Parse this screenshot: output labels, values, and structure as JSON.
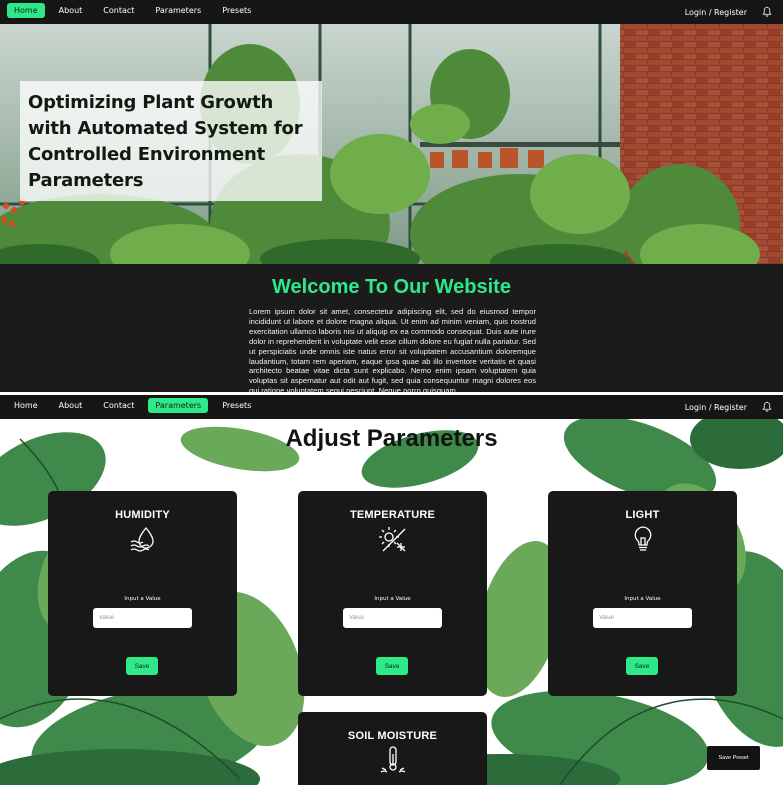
{
  "nav": {
    "links": [
      "Home",
      "About",
      "Contact",
      "Parameters",
      "Presets"
    ],
    "login": "Login / Register"
  },
  "hero": {
    "title": "Optimizing Plant Growth with Automated System for Controlled Environment Parameters"
  },
  "welcome": {
    "title": "Welcome To Our Website",
    "body": "Lorem ipsum dolor sit amet, consectetur adipiscing elit, sed do eiusmod tempor incididunt ut labore et dolore magna aliqua. Ut enim ad minim veniam, quis nostrud exercitation ullamco laboris nisi ut aliquip ex ea commodo consequat. Duis aute irure dolor in reprehenderit in voluptate velit esse cillum dolore eu fugiat nulla pariatur. Sed ut perspiciatis unde omnis iste natus error sit voluptatem accusantium doloremque laudantium, totam rem aperiam, eaque ipsa quae ab illo inventore veritatis et quasi architecto beatae vitae dicta sunt explicabo. Nemo enim ipsam voluptatem quia voluptas sit aspernatur aut odit aut fugit, sed quia consequuntur magni dolores eos qui ratione voluptatem sequi nesciunt. Neque porro quisquam"
  },
  "params": {
    "title": "Adjust Parameters",
    "cards": [
      {
        "title": "HUMIDITY",
        "icon": "humidity-icon",
        "input_label": "Input a Value",
        "placeholder": "Value",
        "save": "Save"
      },
      {
        "title": "TEMPERATURE",
        "icon": "temperature-icon",
        "input_label": "Input a Value",
        "placeholder": "Value",
        "save": "Save"
      },
      {
        "title": "LIGHT",
        "icon": "light-bulb-icon",
        "input_label": "Input a Value",
        "placeholder": "Value",
        "save": "Save"
      },
      {
        "title": "SOIL MOISTURE",
        "icon": "soil-moisture-icon"
      }
    ],
    "save_preset": "Save Preset"
  },
  "colors": {
    "accent": "#2ee88a",
    "nav_bg": "#161616",
    "card_bg": "#181818"
  }
}
